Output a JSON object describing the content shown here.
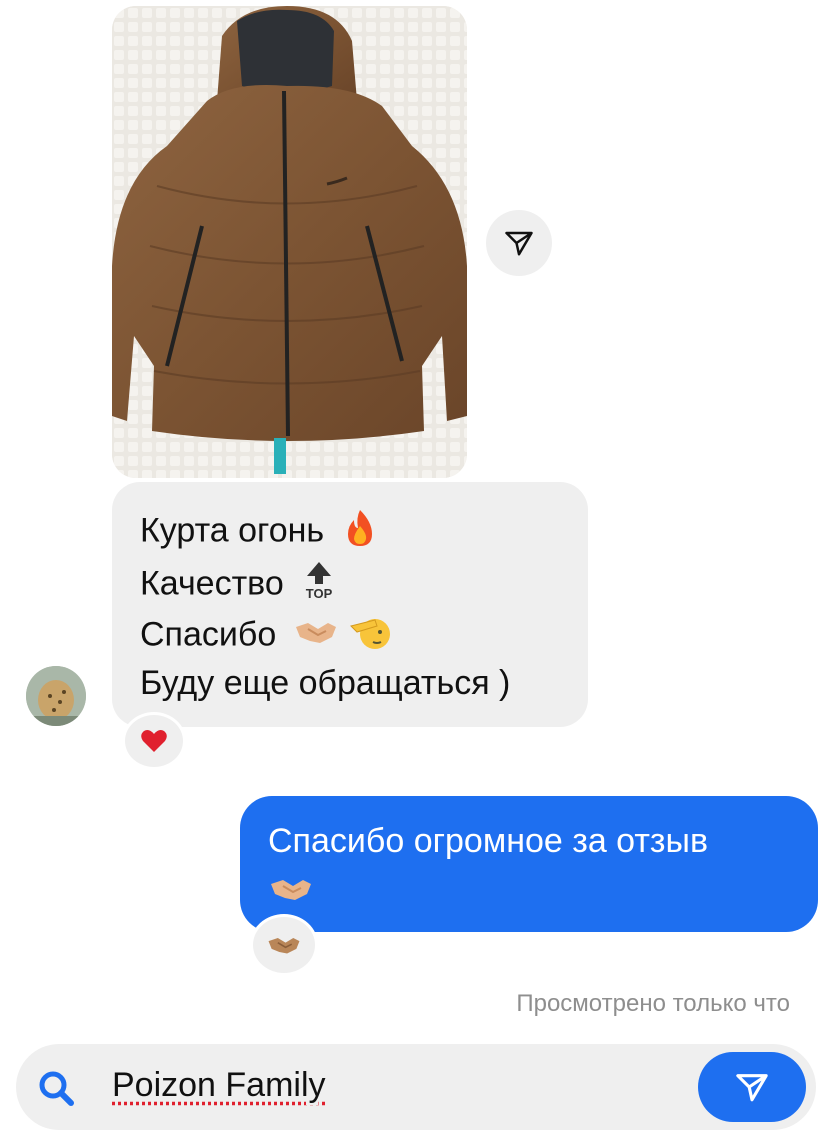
{
  "thread": {
    "incoming_message": {
      "lines": [
        "Курта огонь",
        "Качество",
        "Спасибо",
        "Буду еще обращаться )"
      ],
      "emojis": [
        "fire-emoji",
        "top-arrow-emoji",
        "handshake-emoji",
        "saluting-face-emoji"
      ],
      "top_emoji_text": "TOP",
      "reaction": "red-heart-emoji"
    },
    "outgoing_message": {
      "text": "Спасибо огромное за отзыв",
      "emoji": "handshake-emoji",
      "reaction": "handshake-emoji"
    },
    "seen_status": "Просмотрено только что"
  },
  "photo": {
    "subject": "brown-puffer-jacket-photo"
  },
  "composer": {
    "value": "Poizon Family",
    "search_icon": "search-icon",
    "send_icon": "send-icon"
  },
  "colors": {
    "accent": "#1e6ff0",
    "bubble_gray": "#efefef",
    "seen_text": "#8e8e8e"
  }
}
